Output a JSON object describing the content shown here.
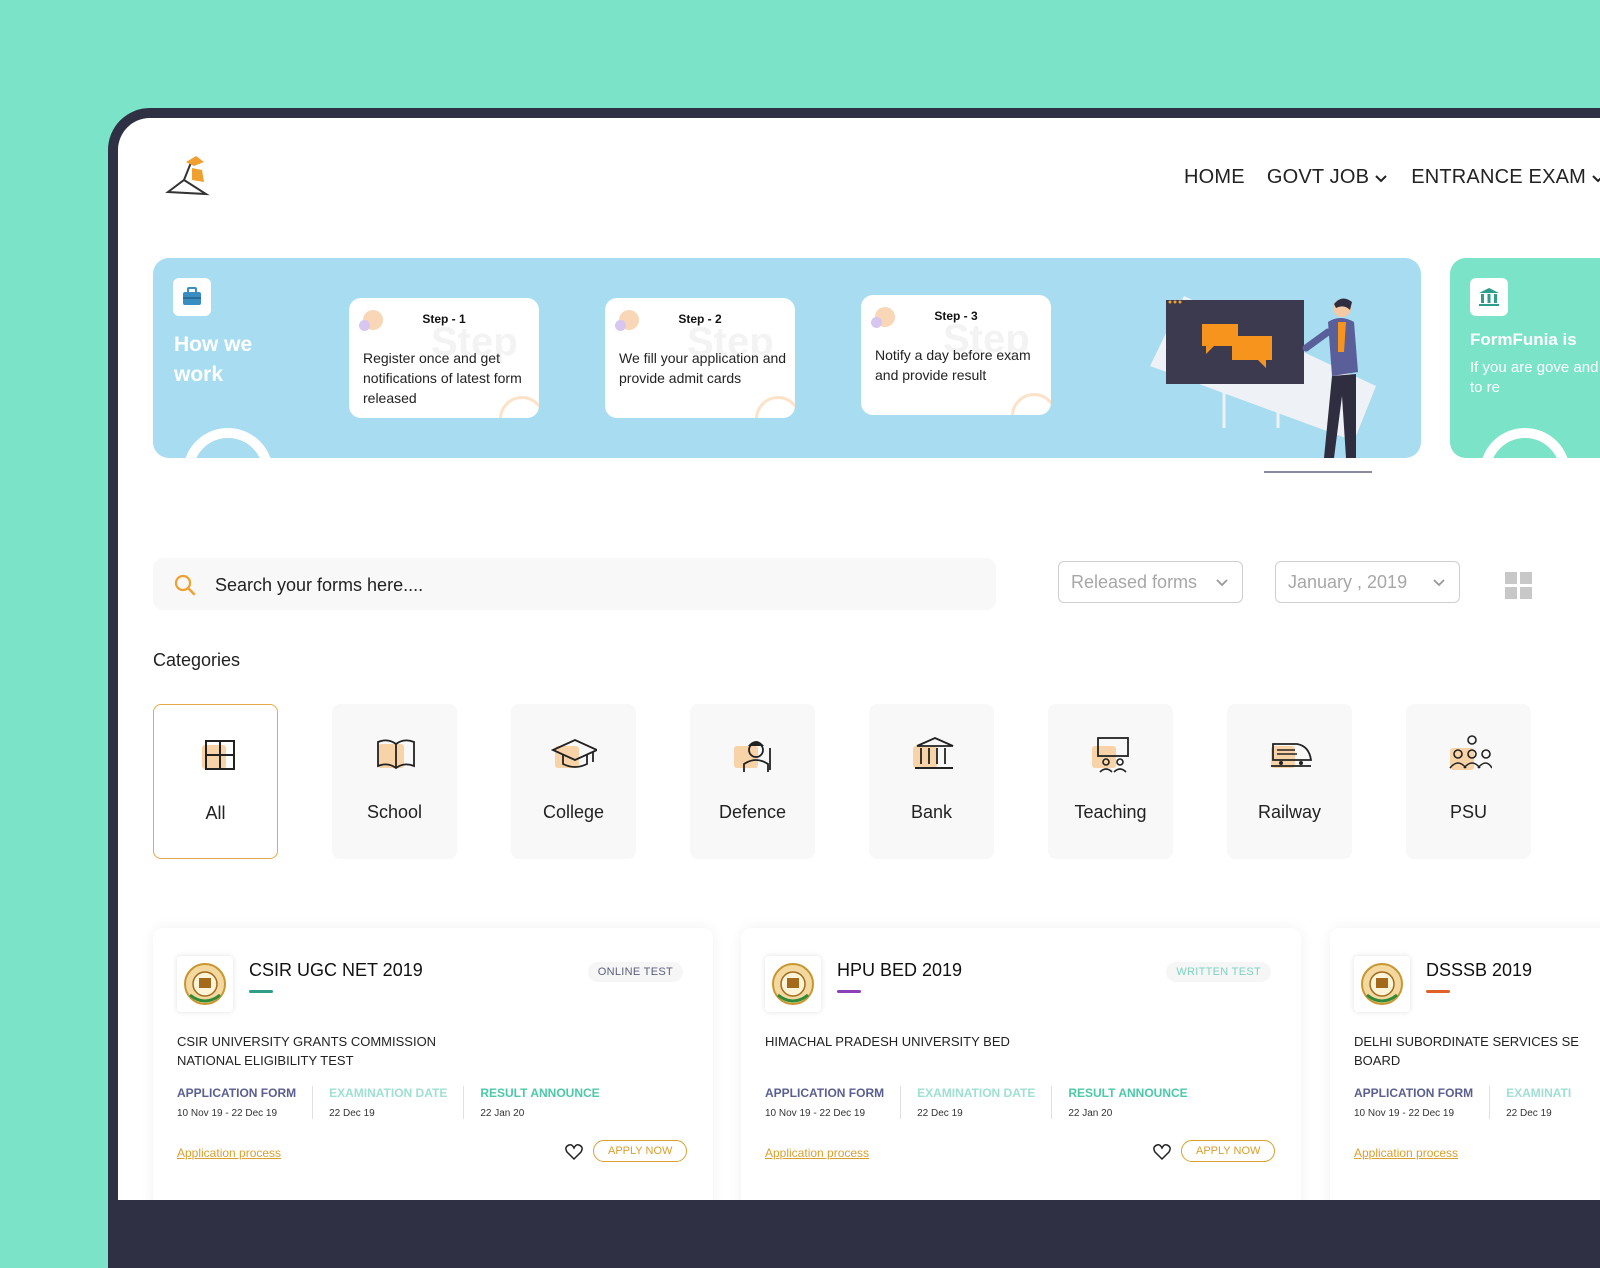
{
  "nav": {
    "items": [
      {
        "label": "HOME",
        "dropdown": false
      },
      {
        "label": "GOVT JOB",
        "dropdown": true
      },
      {
        "label": "ENTRANCE EXAM",
        "dropdown": true
      }
    ]
  },
  "how_we_work": {
    "title": "How we work",
    "steps": [
      {
        "label": "Step - 1",
        "ghost": "Step",
        "text": "Register once and get notifications of latest form released"
      },
      {
        "label": "Step - 2",
        "ghost": "Step",
        "text": "We fill your application and provide admit cards"
      },
      {
        "label": "Step - 3",
        "ghost": "Step",
        "text": "Notify a day before exam and provide result"
      }
    ]
  },
  "promo": {
    "title": "FormFunia is",
    "text": "If you are gove and want to re"
  },
  "search": {
    "placeholder": "Search your forms here...."
  },
  "filters": {
    "status": {
      "value": "Released forms"
    },
    "month": {
      "value": "January , 2019"
    }
  },
  "categories": {
    "title": "Categories",
    "items": [
      {
        "label": "All",
        "icon": "grid-icon",
        "active": true
      },
      {
        "label": "School",
        "icon": "book-icon",
        "active": false
      },
      {
        "label": "College",
        "icon": "graduation-cap-icon",
        "active": false
      },
      {
        "label": "Defence",
        "icon": "soldier-icon",
        "active": false
      },
      {
        "label": "Bank",
        "icon": "bank-icon",
        "active": false
      },
      {
        "label": "Teaching",
        "icon": "teaching-board-icon",
        "active": false
      },
      {
        "label": "Railway",
        "icon": "train-icon",
        "active": false
      },
      {
        "label": "PSU",
        "icon": "people-group-icon",
        "active": false
      }
    ]
  },
  "jobs": [
    {
      "name": "CSIR UGC NET 2019",
      "badge": "ONLINE TEST",
      "badge_color": "#5a5f7a",
      "accent": "#2e9d8a",
      "full_name": "CSIR UNIVERSITY GRANTS COMMISSION NATIONAL ELIGIBILITY TEST",
      "application_label": "APPLICATION FORM",
      "application_dates": "10 Nov 19 - 22 Dec 19",
      "exam_label": "EXAMINATION DATE",
      "exam_date": "22 Dec 19",
      "result_label": "RESULT ANNOUNCE",
      "result_date": "22 Jan 20",
      "process_link": "Application process",
      "apply_label": "APPLY NOW"
    },
    {
      "name": "HPU BED 2019",
      "badge": "WRITTEN TEST",
      "badge_color": "#7ad4c0",
      "accent": "#8b3fb8",
      "full_name": "HIMACHAL PRADESH UNIVERSITY BED",
      "application_label": "APPLICATION FORM",
      "application_dates": "10 Nov 19 - 22 Dec 19",
      "exam_label": "EXAMINATION DATE",
      "exam_date": "22 Dec 19",
      "result_label": "RESULT ANNOUNCE",
      "result_date": "22 Jan 20",
      "process_link": "Application process",
      "apply_label": "APPLY NOW"
    },
    {
      "name": "DSSSB 2019",
      "badge": "",
      "badge_color": "#5a5f7a",
      "accent": "#e0622a",
      "full_name": "DELHI SUBORDINATE SERVICES SE BOARD",
      "application_label": "APPLICATION FORM",
      "application_dates": "10 Nov 19 - 22 Dec 19",
      "exam_label": "EXAMINATI",
      "exam_date": "22 Dec 19",
      "result_label": "",
      "result_date": "",
      "process_link": "Application process",
      "apply_label": ""
    }
  ],
  "colors": {
    "background": "#7ae3c8",
    "banner": "#a8dcf0",
    "accent_orange": "#e6a849",
    "label_purple": "#5a5f8f",
    "label_teal": "#9fe0d2",
    "label_green": "#4cc9a8"
  }
}
